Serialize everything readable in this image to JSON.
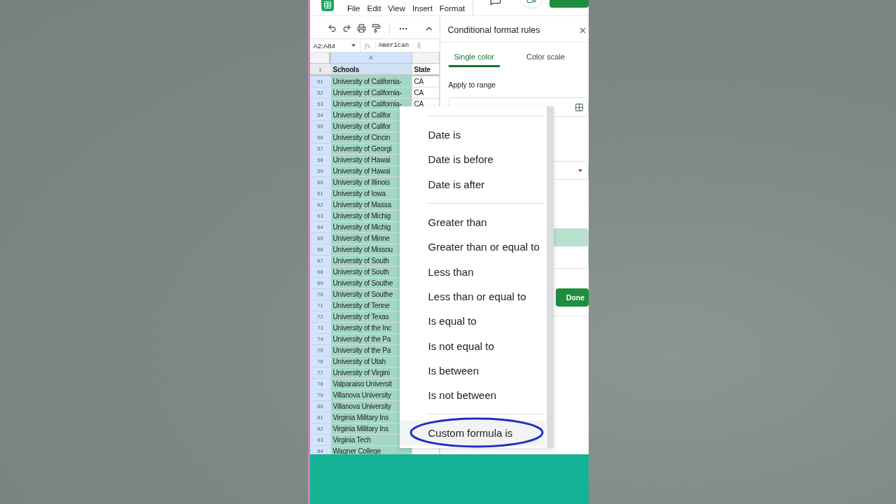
{
  "menu_bar": [
    "File",
    "Edit",
    "View",
    "Insert",
    "Format"
  ],
  "name_box": "A2:A84",
  "formula_label": "fx",
  "formula": "American",
  "column_headers": [
    "A"
  ],
  "header_row": {
    "number": "1",
    "cells": [
      "Schools",
      "State"
    ]
  },
  "rows": [
    {
      "number": "51",
      "school": "University of California-",
      "state": "CA"
    },
    {
      "number": "52",
      "school": "University of California-",
      "state": "CA"
    },
    {
      "number": "53",
      "school": "University of California-",
      "state": "CA"
    },
    {
      "number": "54",
      "school": "University of Califor"
    },
    {
      "number": "55",
      "school": "University of Califor"
    },
    {
      "number": "56",
      "school": "University of Cincin"
    },
    {
      "number": "57",
      "school": "University of Georgi"
    },
    {
      "number": "58",
      "school": "University of Hawai"
    },
    {
      "number": "59",
      "school": "University of Hawai"
    },
    {
      "number": "60",
      "school": "University of Illinois"
    },
    {
      "number": "61",
      "school": "University of Iowa"
    },
    {
      "number": "62",
      "school": "University of Massa"
    },
    {
      "number": "63",
      "school": "University of Michig"
    },
    {
      "number": "64",
      "school": "University of Michig"
    },
    {
      "number": "65",
      "school": "University of Minne"
    },
    {
      "number": "66",
      "school": "University of Missou"
    },
    {
      "number": "67",
      "school": "University of South"
    },
    {
      "number": "68",
      "school": "University of South"
    },
    {
      "number": "69",
      "school": "University of Southe"
    },
    {
      "number": "70",
      "school": "University of Southe"
    },
    {
      "number": "71",
      "school": "University of Tenne"
    },
    {
      "number": "72",
      "school": "University of Texas"
    },
    {
      "number": "73",
      "school": "University of the Inc"
    },
    {
      "number": "74",
      "school": "University of the Pa"
    },
    {
      "number": "75",
      "school": "University of the Pa"
    },
    {
      "number": "76",
      "school": "University of Utah"
    },
    {
      "number": "77",
      "school": "University of Virgini"
    },
    {
      "number": "78",
      "school": "Valparaiso Universit"
    },
    {
      "number": "79",
      "school": "Villanova University"
    },
    {
      "number": "80",
      "school": "Villanova University"
    },
    {
      "number": "81",
      "school": "Virginia Military Ins"
    },
    {
      "number": "82",
      "school": "Virginia Military Ins"
    },
    {
      "number": "83",
      "school": "Virginia Tech"
    },
    {
      "number": "84",
      "school": "Wagner College"
    }
  ],
  "panel": {
    "title": "Conditional format rules",
    "tabs": [
      {
        "label": "Single color",
        "selected": true
      },
      {
        "label": "Color scale",
        "selected": false
      }
    ],
    "apply_label": "Apply to range",
    "done_button": "Done"
  },
  "condition_menu": [
    {
      "kind": "divider"
    },
    {
      "kind": "option",
      "label": "Date is",
      "highlighted": false,
      "circled": false
    },
    {
      "kind": "option",
      "label": "Date is before",
      "highlighted": false,
      "circled": false
    },
    {
      "kind": "option",
      "label": "Date is after",
      "highlighted": false,
      "circled": false
    },
    {
      "kind": "divider"
    },
    {
      "kind": "option",
      "label": "Greater than",
      "highlighted": false,
      "circled": false
    },
    {
      "kind": "option",
      "label": "Greater than or equal to",
      "highlighted": false,
      "circled": false
    },
    {
      "kind": "option",
      "label": "Less than",
      "highlighted": false,
      "circled": false
    },
    {
      "kind": "option",
      "label": "Less than or equal to",
      "highlighted": false,
      "circled": false
    },
    {
      "kind": "option",
      "label": "Is equal to",
      "highlighted": false,
      "circled": false
    },
    {
      "kind": "option",
      "label": "Is not equal to",
      "highlighted": false,
      "circled": false
    },
    {
      "kind": "option",
      "label": "Is between",
      "highlighted": false,
      "circled": false
    },
    {
      "kind": "option",
      "label": "Is not between",
      "highlighted": false,
      "circled": false
    },
    {
      "kind": "divider"
    },
    {
      "kind": "option",
      "label": "Custom formula is",
      "highlighted": true,
      "circled": true
    }
  ]
}
